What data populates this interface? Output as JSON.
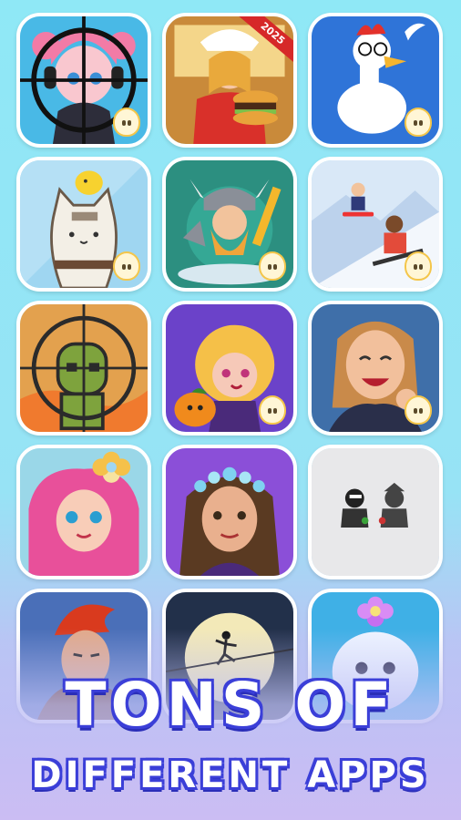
{
  "headline": {
    "line1": "TONS OF",
    "line2": "DIFFERENT APPS"
  },
  "apps": [
    {
      "icon": "sniper-anime-girl-icon",
      "badge": true
    },
    {
      "icon": "burger-chef-girl-icon",
      "badge_text": "2025",
      "badge": false
    },
    {
      "icon": "screaming-chicken-icon",
      "badge": true
    },
    {
      "icon": "cat-and-bird-icon",
      "badge": true
    },
    {
      "icon": "viking-warrior-icon",
      "badge": true
    },
    {
      "icon": "snowboard-ski-icon",
      "badge": true
    },
    {
      "icon": "zombie-target-icon",
      "badge": false
    },
    {
      "icon": "fairy-pumpkin-icon",
      "badge": true
    },
    {
      "icon": "happy-woman-icon",
      "badge": true
    },
    {
      "icon": "flower-mermaid-icon",
      "badge": false
    },
    {
      "icon": "flower-crown-girl-icon",
      "badge": false
    },
    {
      "icon": "ninja-duo-icon",
      "badge": false
    },
    {
      "icon": "red-hair-warrior-icon",
      "badge": false
    },
    {
      "icon": "moon-stickman-icon",
      "badge": false
    },
    {
      "icon": "cute-flower-blob-icon",
      "badge": false
    }
  ],
  "colors": {
    "background_top": "#8fe8f6",
    "background_bottom": "#c9bdf3",
    "headline_fill": "#ffffff",
    "headline_outline": "#3b3fd8"
  }
}
